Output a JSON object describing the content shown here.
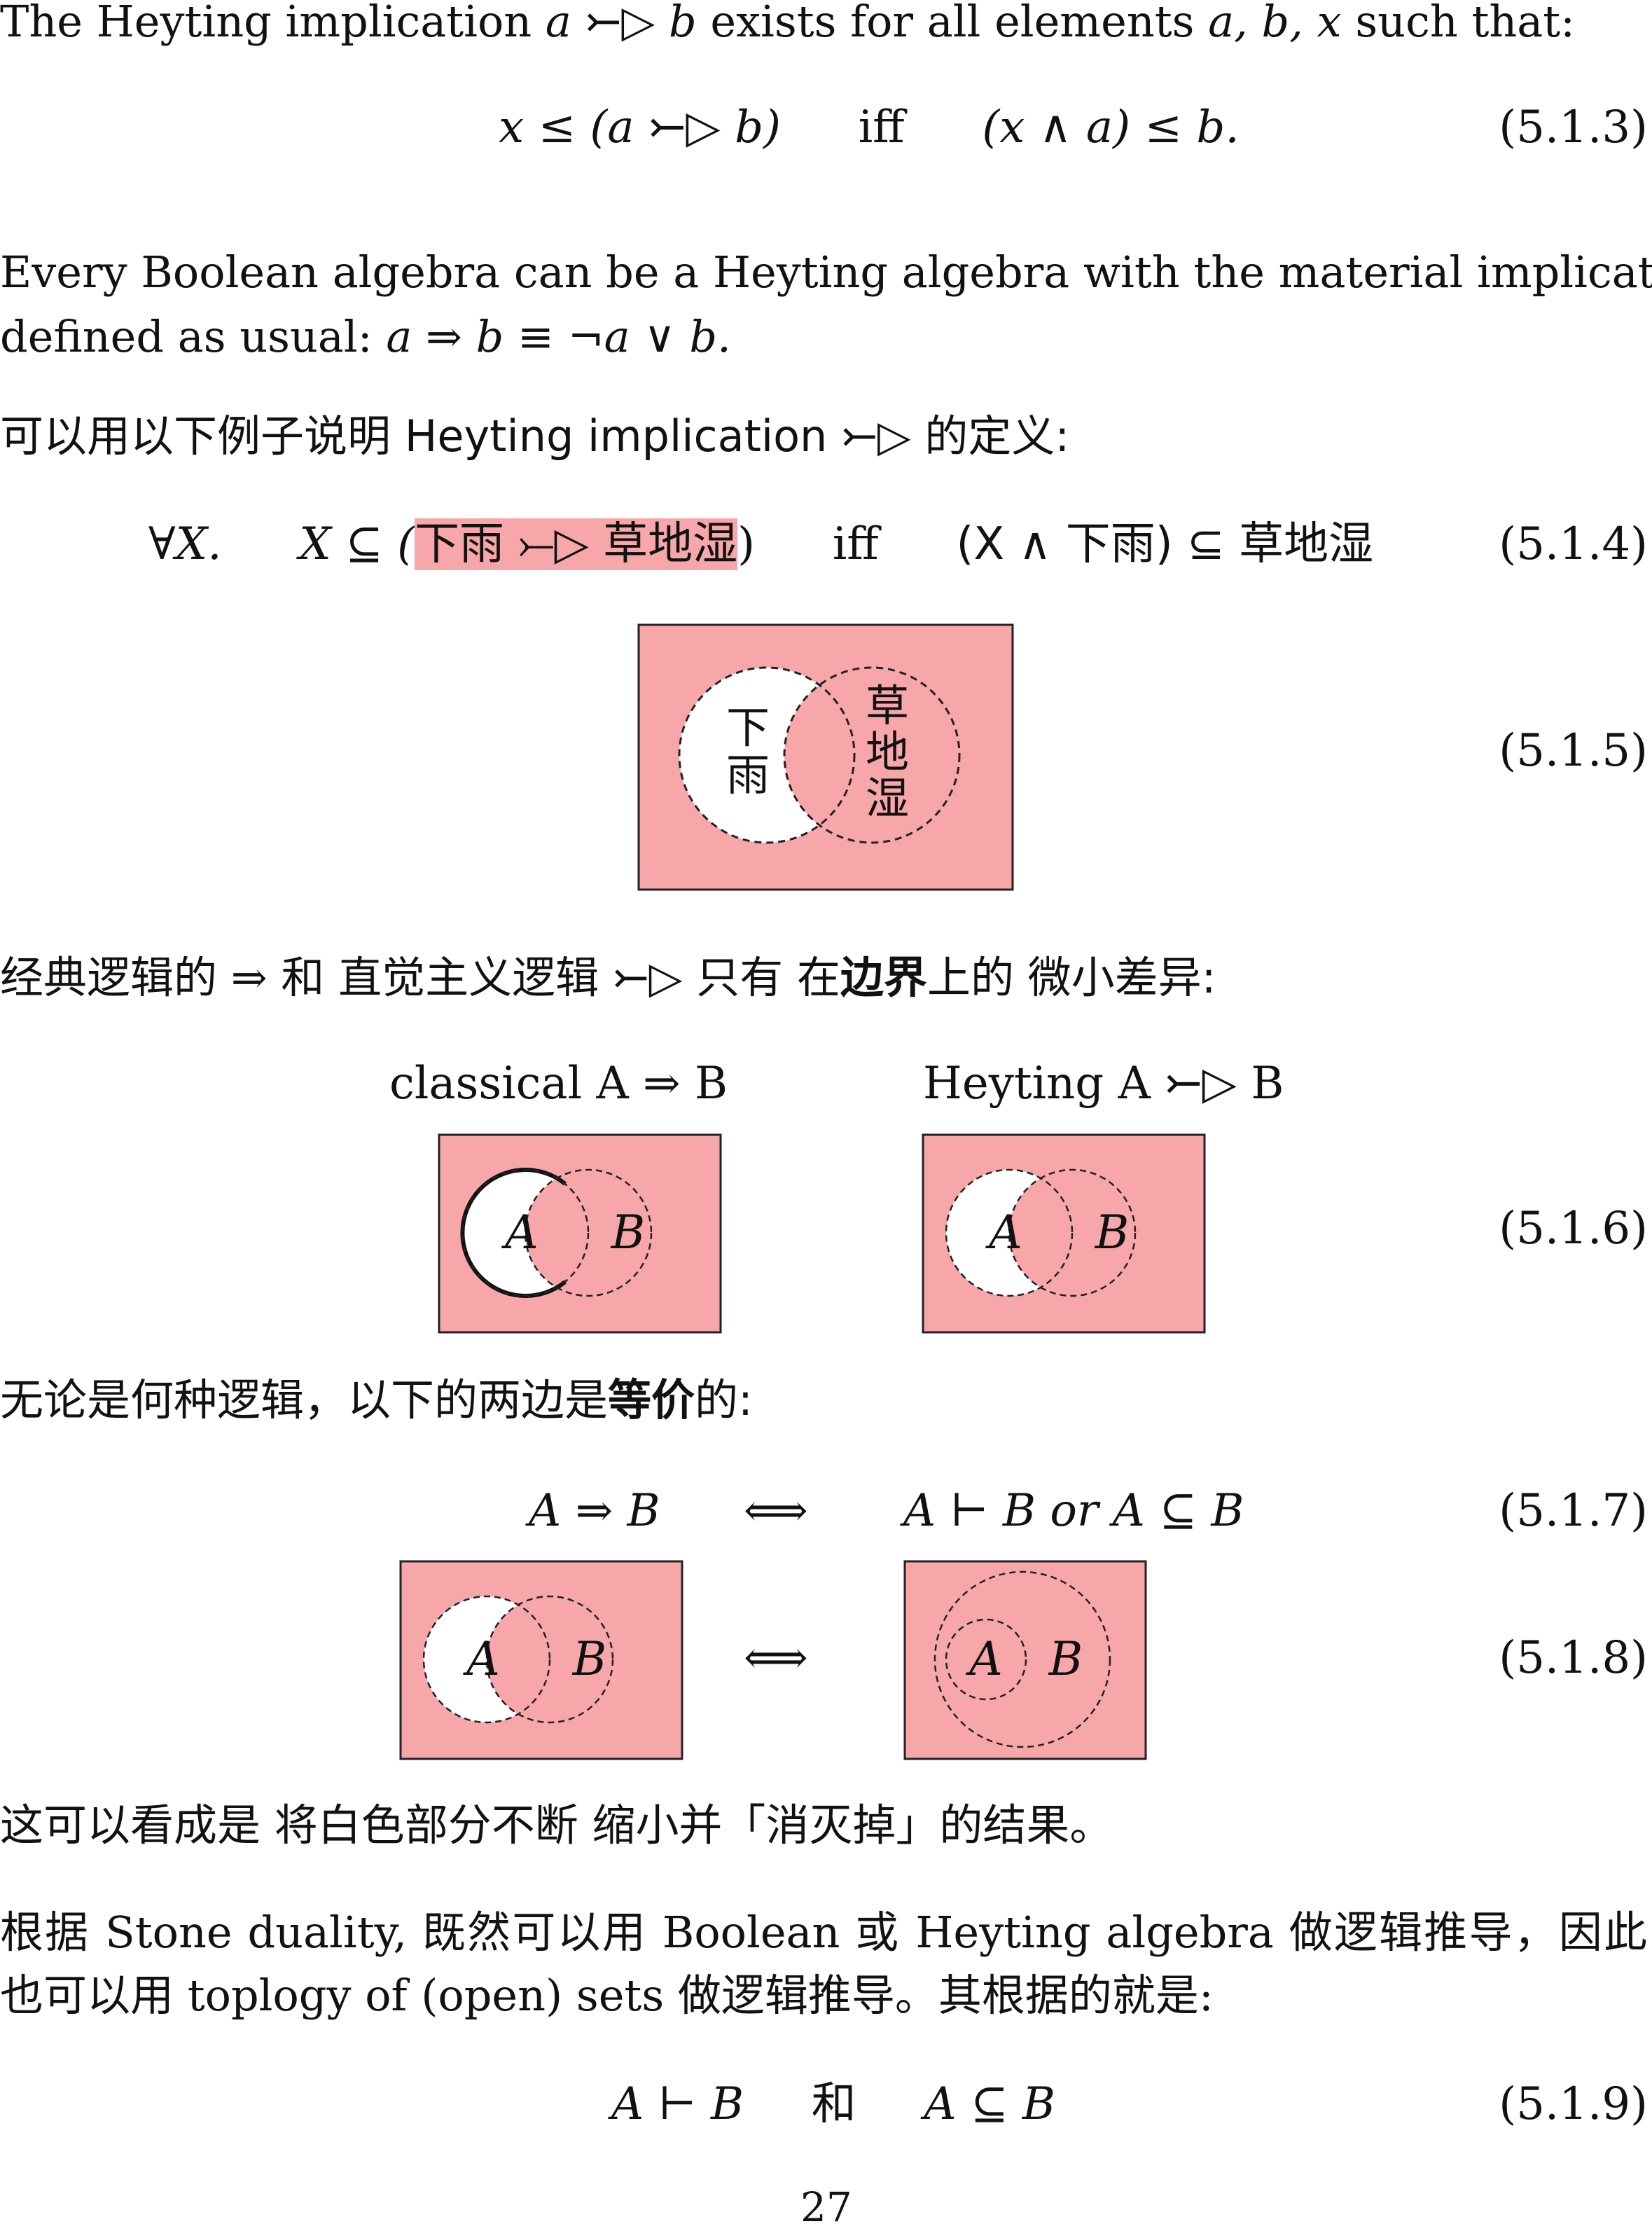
{
  "intro": {
    "p1": "The Heyting implication",
    "p2": "exists for all elements",
    "p3": "such that:"
  },
  "eq_513": {
    "left": "x ≤ (a ⤚▷ b)",
    "iff": "iff",
    "right": "(x ∧ a) ≤ b.",
    "number": "(5.1.3)"
  },
  "boolean_para": {
    "line1": "Every Boolean algebra can be a Heyting algebra with the material implication",
    "line2_text": "defined as usual:",
    "line2_formula": "a ⇒ b ≡ ¬a ∨ b."
  },
  "zh_intro": {
    "text": "可以用以下例子说明 Heyting implication",
    "suffix": "的定义:"
  },
  "eq_514": {
    "forall": "∀X.",
    "lhs": "X ⊆ (",
    "highlight": "下雨 ⤚▷ 草地湿",
    "close": ")",
    "iff": "iff",
    "rhs": "(X ∧ 下雨) ⊆ 草地湿",
    "number": "(5.1.4)"
  },
  "venn_515": {
    "left_label": "下雨",
    "right_label": "草地湿",
    "number": "(5.1.5)"
  },
  "zh_compare": {
    "t1": "经典逻辑的",
    "t2": "和 直觉主义逻辑",
    "t3": "只有 在",
    "bold": "边界",
    "t4": "上的 微小差异:"
  },
  "eq_516": {
    "classical_label": "classical A ⇒ B",
    "heyting_label": "Heyting A ⤚▷ B",
    "a": "A",
    "b": "B",
    "number": "(5.1.6)"
  },
  "zh_equiv": {
    "t1": "无论是何种逻辑，以下的两边是",
    "bold": "等价",
    "t2": "的:"
  },
  "eq_517": {
    "left": "A ⇒ B",
    "arrow": "⟺",
    "right": "A ⊢ B or A ⊆ B",
    "number": "(5.1.7)"
  },
  "eq_518": {
    "arrow": "⟺",
    "a": "A",
    "b": "B",
    "number": "(5.1.8)"
  },
  "zh_shrink": {
    "text": "这可以看成是 将白色部分不断 缩小并「消灭掉」的结果。"
  },
  "stone_para": {
    "line1": "根据 Stone duality, 既然可以用 Boolean 或 Heyting algebra 做逻辑推导，因此",
    "line2": "也可以用 toplogy of (open) sets 做逻辑推导。其根据的就是:"
  },
  "eq_519": {
    "left": "A ⊢ B",
    "and": "和",
    "right": "A ⊆ B",
    "number": "(5.1.9)"
  },
  "page_number": "27",
  "colors": {
    "pink": "#f7a7aa",
    "ink": "#111111"
  }
}
